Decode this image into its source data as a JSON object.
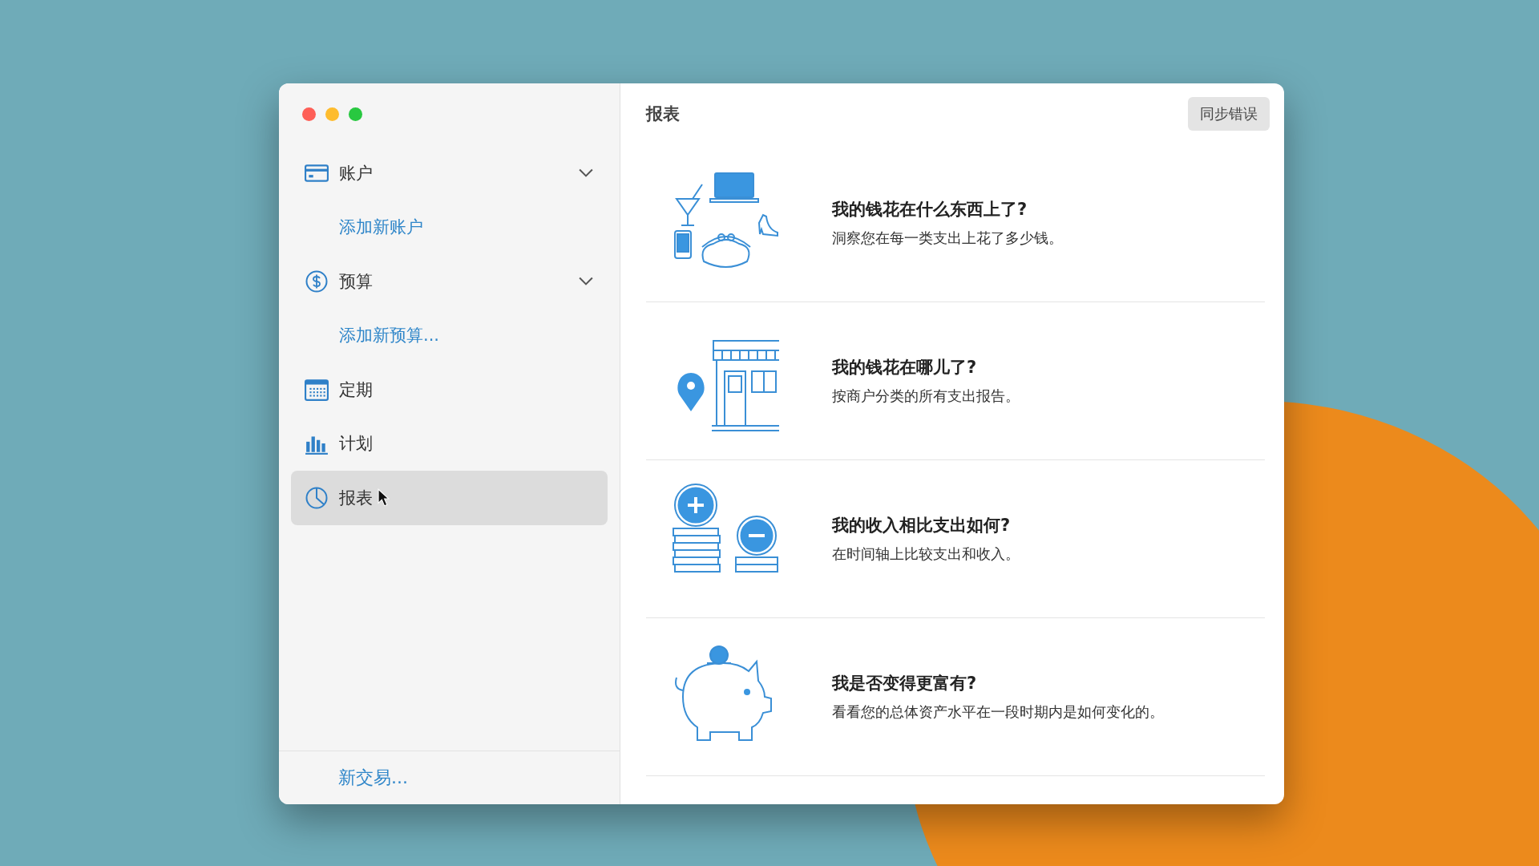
{
  "window": {
    "title": "报表",
    "sync_button": "同步错误"
  },
  "sidebar": {
    "items": [
      {
        "kind": "section",
        "label": "账户",
        "expanded": true,
        "selected": false
      },
      {
        "kind": "link",
        "label": "添加新账户",
        "selected": false
      },
      {
        "kind": "section",
        "label": "预算",
        "expanded": true,
        "selected": false
      },
      {
        "kind": "link",
        "label": "添加新预算...",
        "selected": false
      },
      {
        "kind": "item",
        "label": "定期",
        "selected": false
      },
      {
        "kind": "item",
        "label": "计划",
        "selected": false
      },
      {
        "kind": "item",
        "label": "报表",
        "selected": true
      }
    ],
    "footer": "新交易..."
  },
  "reports": [
    {
      "title": "我的钱花在什么东西上了?",
      "description": "洞察您在每一类支出上花了多少钱。"
    },
    {
      "title": "我的钱花在哪儿了?",
      "description": "按商户分类的所有支出报告。"
    },
    {
      "title": "我的收入相比支出如何?",
      "description": "在时间轴上比较支出和收入。"
    },
    {
      "title": "我是否变得更富有?",
      "description": "看看您的总体资产水平在一段时期内是如何变化的。"
    }
  ]
}
